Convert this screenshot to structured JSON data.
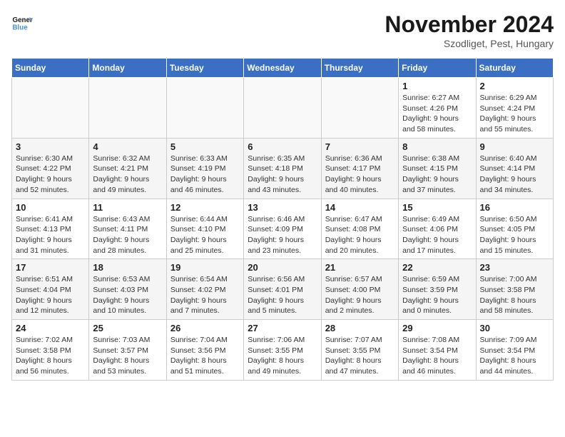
{
  "header": {
    "logo_line1": "General",
    "logo_line2": "Blue",
    "month_title": "November 2024",
    "subtitle": "Szodliget, Pest, Hungary"
  },
  "weekdays": [
    "Sunday",
    "Monday",
    "Tuesday",
    "Wednesday",
    "Thursday",
    "Friday",
    "Saturday"
  ],
  "weeks": [
    [
      {
        "day": "",
        "info": ""
      },
      {
        "day": "",
        "info": ""
      },
      {
        "day": "",
        "info": ""
      },
      {
        "day": "",
        "info": ""
      },
      {
        "day": "",
        "info": ""
      },
      {
        "day": "1",
        "info": "Sunrise: 6:27 AM\nSunset: 4:26 PM\nDaylight: 9 hours\nand 58 minutes."
      },
      {
        "day": "2",
        "info": "Sunrise: 6:29 AM\nSunset: 4:24 PM\nDaylight: 9 hours\nand 55 minutes."
      }
    ],
    [
      {
        "day": "3",
        "info": "Sunrise: 6:30 AM\nSunset: 4:22 PM\nDaylight: 9 hours\nand 52 minutes."
      },
      {
        "day": "4",
        "info": "Sunrise: 6:32 AM\nSunset: 4:21 PM\nDaylight: 9 hours\nand 49 minutes."
      },
      {
        "day": "5",
        "info": "Sunrise: 6:33 AM\nSunset: 4:19 PM\nDaylight: 9 hours\nand 46 minutes."
      },
      {
        "day": "6",
        "info": "Sunrise: 6:35 AM\nSunset: 4:18 PM\nDaylight: 9 hours\nand 43 minutes."
      },
      {
        "day": "7",
        "info": "Sunrise: 6:36 AM\nSunset: 4:17 PM\nDaylight: 9 hours\nand 40 minutes."
      },
      {
        "day": "8",
        "info": "Sunrise: 6:38 AM\nSunset: 4:15 PM\nDaylight: 9 hours\nand 37 minutes."
      },
      {
        "day": "9",
        "info": "Sunrise: 6:40 AM\nSunset: 4:14 PM\nDaylight: 9 hours\nand 34 minutes."
      }
    ],
    [
      {
        "day": "10",
        "info": "Sunrise: 6:41 AM\nSunset: 4:13 PM\nDaylight: 9 hours\nand 31 minutes."
      },
      {
        "day": "11",
        "info": "Sunrise: 6:43 AM\nSunset: 4:11 PM\nDaylight: 9 hours\nand 28 minutes."
      },
      {
        "day": "12",
        "info": "Sunrise: 6:44 AM\nSunset: 4:10 PM\nDaylight: 9 hours\nand 25 minutes."
      },
      {
        "day": "13",
        "info": "Sunrise: 6:46 AM\nSunset: 4:09 PM\nDaylight: 9 hours\nand 23 minutes."
      },
      {
        "day": "14",
        "info": "Sunrise: 6:47 AM\nSunset: 4:08 PM\nDaylight: 9 hours\nand 20 minutes."
      },
      {
        "day": "15",
        "info": "Sunrise: 6:49 AM\nSunset: 4:06 PM\nDaylight: 9 hours\nand 17 minutes."
      },
      {
        "day": "16",
        "info": "Sunrise: 6:50 AM\nSunset: 4:05 PM\nDaylight: 9 hours\nand 15 minutes."
      }
    ],
    [
      {
        "day": "17",
        "info": "Sunrise: 6:51 AM\nSunset: 4:04 PM\nDaylight: 9 hours\nand 12 minutes."
      },
      {
        "day": "18",
        "info": "Sunrise: 6:53 AM\nSunset: 4:03 PM\nDaylight: 9 hours\nand 10 minutes."
      },
      {
        "day": "19",
        "info": "Sunrise: 6:54 AM\nSunset: 4:02 PM\nDaylight: 9 hours\nand 7 minutes."
      },
      {
        "day": "20",
        "info": "Sunrise: 6:56 AM\nSunset: 4:01 PM\nDaylight: 9 hours\nand 5 minutes."
      },
      {
        "day": "21",
        "info": "Sunrise: 6:57 AM\nSunset: 4:00 PM\nDaylight: 9 hours\nand 2 minutes."
      },
      {
        "day": "22",
        "info": "Sunrise: 6:59 AM\nSunset: 3:59 PM\nDaylight: 9 hours\nand 0 minutes."
      },
      {
        "day": "23",
        "info": "Sunrise: 7:00 AM\nSunset: 3:58 PM\nDaylight: 8 hours\nand 58 minutes."
      }
    ],
    [
      {
        "day": "24",
        "info": "Sunrise: 7:02 AM\nSunset: 3:58 PM\nDaylight: 8 hours\nand 56 minutes."
      },
      {
        "day": "25",
        "info": "Sunrise: 7:03 AM\nSunset: 3:57 PM\nDaylight: 8 hours\nand 53 minutes."
      },
      {
        "day": "26",
        "info": "Sunrise: 7:04 AM\nSunset: 3:56 PM\nDaylight: 8 hours\nand 51 minutes."
      },
      {
        "day": "27",
        "info": "Sunrise: 7:06 AM\nSunset: 3:55 PM\nDaylight: 8 hours\nand 49 minutes."
      },
      {
        "day": "28",
        "info": "Sunrise: 7:07 AM\nSunset: 3:55 PM\nDaylight: 8 hours\nand 47 minutes."
      },
      {
        "day": "29",
        "info": "Sunrise: 7:08 AM\nSunset: 3:54 PM\nDaylight: 8 hours\nand 46 minutes."
      },
      {
        "day": "30",
        "info": "Sunrise: 7:09 AM\nSunset: 3:54 PM\nDaylight: 8 hours\nand 44 minutes."
      }
    ]
  ]
}
